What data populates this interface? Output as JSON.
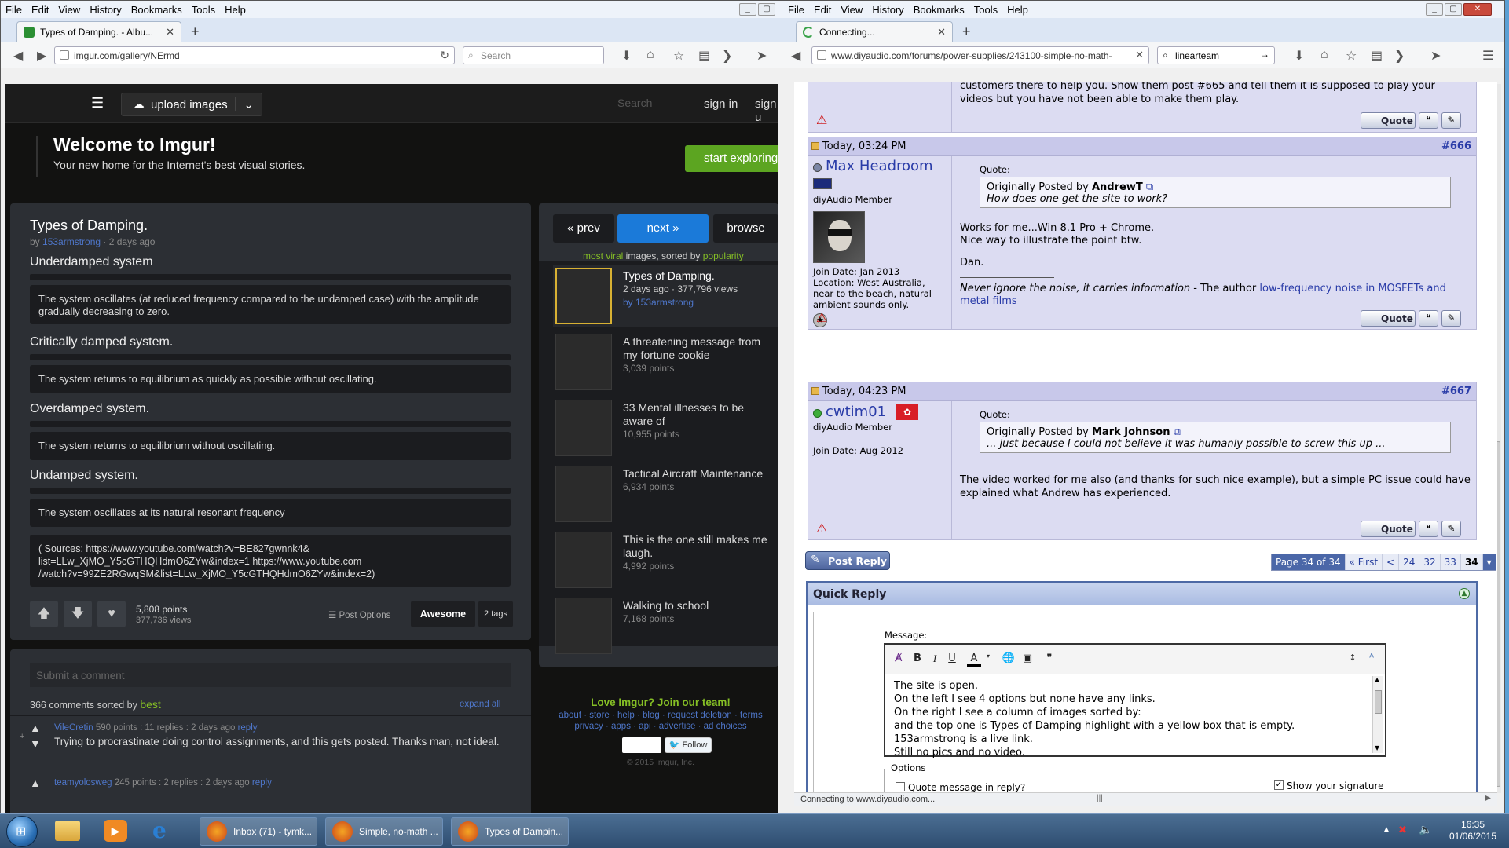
{
  "left_window": {
    "menu": [
      "File",
      "Edit",
      "View",
      "History",
      "Bookmarks",
      "Tools",
      "Help"
    ],
    "tab_title": "Types of Damping. - Albu...",
    "url": "imgur.com/gallery/NErmd",
    "search_placeholder": "Search",
    "imgur": {
      "upload_label": "upload images",
      "search_placeholder": "Search",
      "sign_in": "sign in",
      "sign_up": "sign u",
      "welcome_title": "Welcome to Imgur!",
      "welcome_subtitle": "Your new home for the Internet's best visual stories.",
      "start_exploring": "start exploring",
      "post": {
        "title": "Types of Damping.",
        "by_prefix": "by",
        "author": "153armstrong",
        "age": "· 2 days ago",
        "sections": [
          {
            "title": "Underdamped system",
            "desc": "The system oscillates (at reduced frequency compared to the undamped case) with the amplitude gradually decreasing to zero."
          },
          {
            "title": "Critically damped system.",
            "desc": "The system returns to equilibrium as quickly as possible without oscillating."
          },
          {
            "title": "Overdamped system.",
            "desc": "The system returns to equilibrium without oscillating."
          },
          {
            "title": "Undamped system.",
            "desc": "The system oscillates at its natural resonant frequency"
          }
        ],
        "sources": "( Sources: https://www.youtube.com/watch?v=BE827gwnnk4&\nlist=LLw_XjMO_Y5cGTHQHdmO6ZYw&index=1 https://www.youtube.com\n/watch?v=99ZE2RGwqSM&list=LLw_XjMO_Y5cGTHQHdmO6ZYw&index=2)",
        "points": "5,808 points",
        "views": "377,736 views",
        "post_options": "Post Options",
        "tag_awesome": "Awesome",
        "tag_count": "2 tags"
      },
      "nav": {
        "prev": "« prev",
        "next": "next »",
        "browse": "browse"
      },
      "sort_line": {
        "a": "most viral",
        "b": " images, sorted by ",
        "c": "popularity"
      },
      "gallery": [
        {
          "title": "Types of Damping.",
          "meta": "2 days ago · 377,796 views",
          "by": "by 153armstrong"
        },
        {
          "title": "A threatening message from my fortune cookie",
          "meta": "3,039 points"
        },
        {
          "title": "33 Mental illnesses to be aware of",
          "meta": "10,955 points"
        },
        {
          "title": "Tactical Aircraft Maintenance",
          "meta": "6,934 points"
        },
        {
          "title": "This is the one still makes me laugh.",
          "meta": "4,992 points"
        },
        {
          "title": "Walking to school",
          "meta": "7,168 points"
        }
      ],
      "footer": {
        "join": "Love Imgur? Join our team!",
        "links1": "about · store · help · blog · request deletion · terms",
        "links2": "privacy · apps · api · advertise · ad choices",
        "follow": "Follow",
        "copyright": "© 2015 Imgur, Inc."
      },
      "comments": {
        "placeholder": "Submit a comment",
        "count": "366 comments sorted by",
        "sort": "best",
        "expand": "expand all",
        "items": [
          {
            "user": "VileCretin",
            "meta": "590 points : 11 replies : 2 days ago",
            "reply": "reply",
            "text": "Trying to procrastinate doing control assignments, and this gets posted. Thanks man, not ideal."
          },
          {
            "user": "teamyolosweg",
            "meta": "245 points : 2 replies : 2 days ago",
            "reply": "reply",
            "text": ""
          }
        ]
      }
    }
  },
  "right_window": {
    "menu": [
      "File",
      "Edit",
      "View",
      "History",
      "Bookmarks",
      "Tools",
      "Help"
    ],
    "tab_title": "Connecting...",
    "url": "www.diyaudio.com/forums/power-supplies/243100-simple-no-math-",
    "search_value": "linearteam",
    "status": "Connecting to www.diyaudio.com...",
    "top_post_text": "customers there to help you. Show them post #665 and tell them it is supposed to play your\nvideos but you have not been able to make them play.",
    "posts": [
      {
        "date": "Today, 03:24 PM",
        "number": "#666",
        "user": "Max Headroom",
        "role": "diyAudio Member",
        "join": "Join Date: Jan 2013",
        "location": "Location: West Australia, near to the beach, natural ambient sounds only.",
        "quote_label": "Quote:",
        "quote_prefix": "Originally Posted by",
        "quote_author": "AndrewT",
        "quote_text": "How does one get the site to work?",
        "body1": "Works for me...Win 8.1 Pro + Chrome.",
        "body2": "Nice way to illustrate the point btw.",
        "body3": "Dan.",
        "sig": "Never ignore the noise, it carries information",
        "sig_mid": " - The author ",
        "sig_link": "low-frequency noise in MOSFETs and metal films"
      },
      {
        "date": "Today, 04:23 PM",
        "number": "#667",
        "user": "cwtim01",
        "role": "diyAudio Member",
        "join": "Join Date: Aug 2012",
        "quote_label": "Quote:",
        "quote_prefix": "Originally Posted by",
        "quote_author": "Mark Johnson",
        "quote_text": "... just because I could not believe it was humanly possible to screw this up ...",
        "body1": "The video worked for me also (and thanks for such nice example), but a simple PC issue could have explained what Andrew has experienced."
      }
    ],
    "quote_button": "Quote",
    "post_reply": "Post Reply",
    "pager": [
      "Page 34 of 34",
      "« First",
      "<",
      "24",
      "32",
      "33",
      "34",
      "▾"
    ],
    "quick_reply": {
      "title": "Quick Reply",
      "message_label": "Message:",
      "text": "The site is open.\nOn the left I see 4 options but none have any links.\nOn the right I see a column of images sorted by:\nand the top one is Types of Damping highlight with a yellow box that is empty.\n153armstrong is a live link.\nStill no pics and no video.",
      "options_label": "Options",
      "quote_option": "Quote message in reply?",
      "signature_option": "Show your signature"
    }
  },
  "taskbar": {
    "apps": [
      "Inbox (71) - tymk...",
      "Simple, no-math ...",
      "Types of Dampin..."
    ],
    "time": "16:35",
    "date": "01/06/2015"
  }
}
